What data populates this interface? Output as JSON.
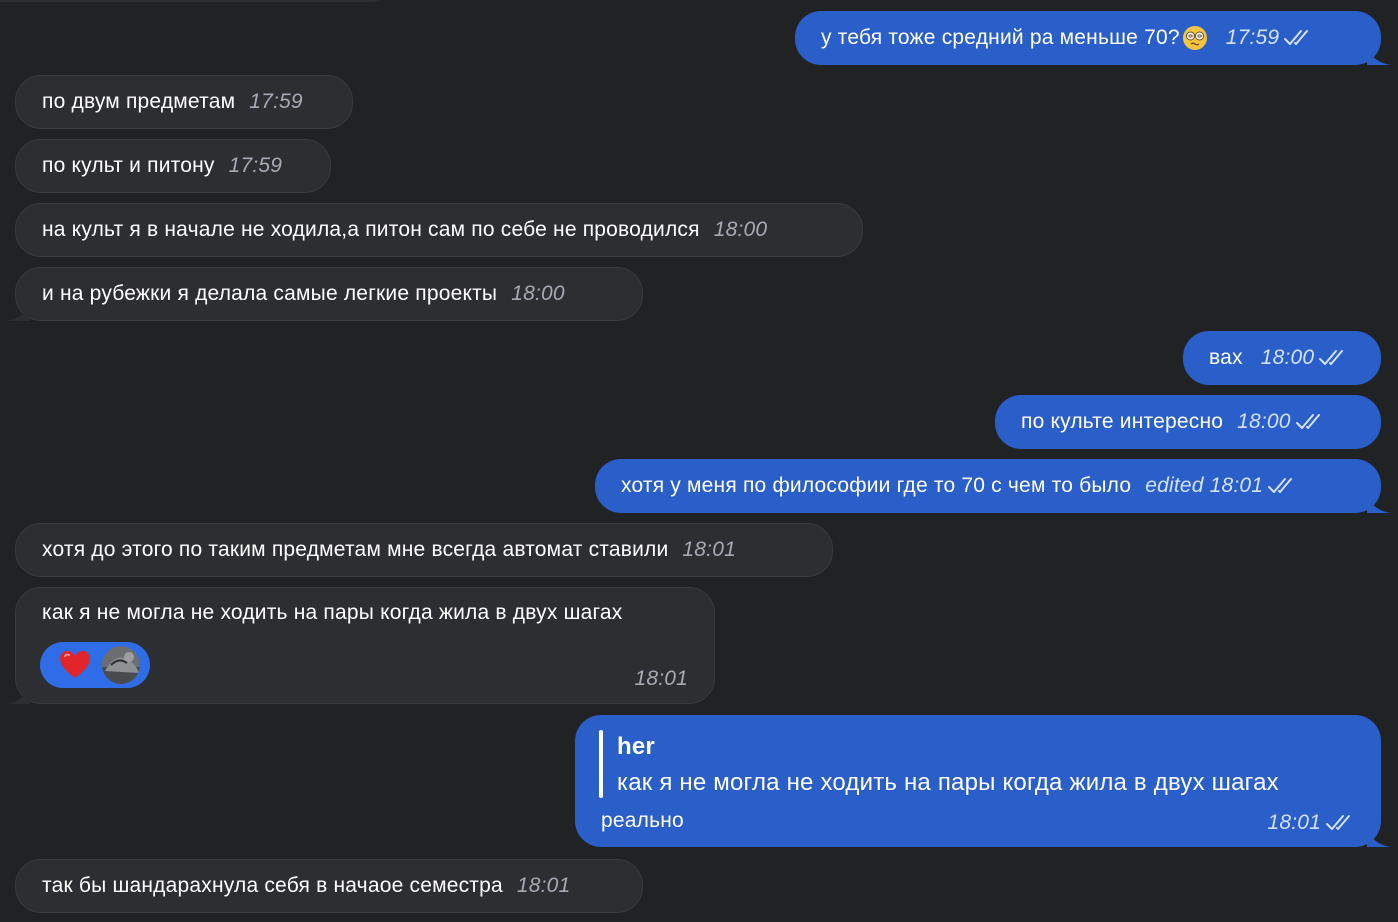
{
  "messages": [
    {
      "side": "out",
      "text": "у тебя тоже средний ра меньше 70?",
      "time": "17:59",
      "emoji": "woozy-face"
    },
    {
      "side": "in",
      "text": "по двум предметам",
      "time": "17:59"
    },
    {
      "side": "in",
      "text": "по культ и питону",
      "time": "17:59"
    },
    {
      "side": "in",
      "text": "на культ я в начале не ходила,а питон сам по себе не проводился",
      "time": "18:00"
    },
    {
      "side": "in",
      "text": "и на рубежки я делала самые легкие проекты",
      "time": "18:00"
    },
    {
      "side": "out",
      "text": "вах",
      "time": "18:00"
    },
    {
      "side": "out",
      "text": "по культе интересно",
      "time": "18:00"
    },
    {
      "side": "out",
      "text": "хотя у меня по философии где то 70 с чем то было",
      "edited": "edited",
      "time": "18:01"
    },
    {
      "side": "in",
      "text": "хотя до этого по таким предметам мне всегда автомат ставили",
      "time": "18:01"
    },
    {
      "side": "in",
      "text": "как я не могла не ходить на пары когда жила в двух шагах",
      "time": "18:01",
      "reaction": "red-heart"
    },
    {
      "side": "out",
      "reply_author": "her",
      "reply_text": "как я не могла не ходить на пары когда жила в двух шагах",
      "text": "реально",
      "time": "18:01"
    },
    {
      "side": "in",
      "text": "так бы шандарахнула себя в начаое семестра",
      "time": "18:01"
    }
  ],
  "colors": {
    "background": "#212224",
    "incoming_bubble": "#2d2e31",
    "outgoing_bubble": "#2a5fc9",
    "reaction_pill": "#2f6de8"
  }
}
